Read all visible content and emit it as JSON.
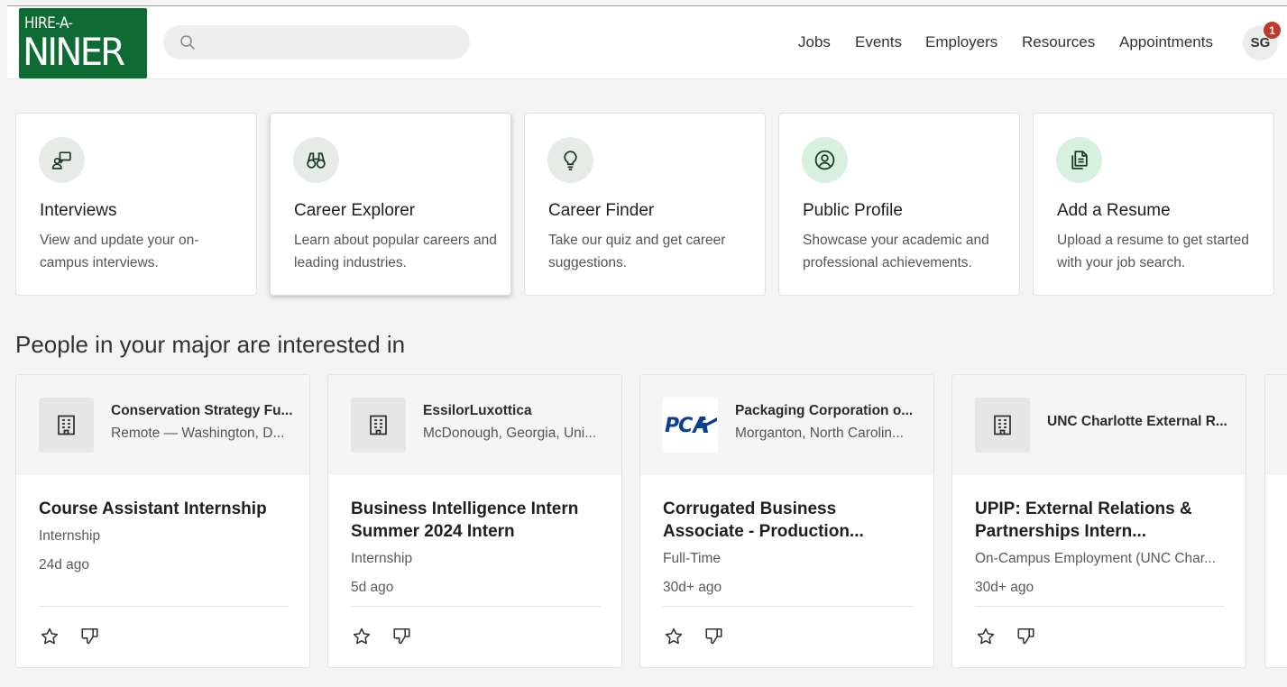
{
  "header": {
    "logo_line1": "HIRE-A-",
    "logo_line2": "NINER",
    "search_placeholder": "",
    "nav": [
      "Jobs",
      "Events",
      "Employers",
      "Resources",
      "Appointments"
    ],
    "avatar_initials": "SG",
    "notification_count": "1"
  },
  "tiles": [
    {
      "title": "Interviews",
      "desc": "View and update your on-campus interviews.",
      "icon": "interview-icon"
    },
    {
      "title": "Career Explorer",
      "desc": "Learn about popular careers and leading industries.",
      "icon": "binoculars-icon"
    },
    {
      "title": "Career Finder",
      "desc": "Take our quiz and get career suggestions.",
      "icon": "lightbulb-icon"
    },
    {
      "title": "Public Profile",
      "desc": "Showcase your academic and professional achievements.",
      "icon": "profile-icon"
    },
    {
      "title": "Add a Resume",
      "desc": "Upload a resume to get started with your job search.",
      "icon": "resume-icon"
    }
  ],
  "section_title": "People in your major are interested in",
  "jobs": [
    {
      "employer": "Conservation Strategy Fu...",
      "location": "Remote — Washington, D...",
      "title": "Course Assistant Internship",
      "type": "Internship",
      "age": "24d ago",
      "logo": "building-icon"
    },
    {
      "employer": "EssilorLuxottica",
      "location": "McDonough, Georgia, Uni...",
      "title": "Business Intelligence Intern Summer 2024 Intern",
      "type": "Internship",
      "age": "5d ago",
      "logo": "building-icon"
    },
    {
      "employer": "Packaging Corporation o...",
      "location": "Morganton, North Carolin...",
      "title": "Corrugated Business Associate - Production...",
      "type": "Full-Time",
      "age": "30d+ ago",
      "logo": "PCA"
    },
    {
      "employer": "UNC Charlotte External R...",
      "location": "",
      "title": "UPIP: External Relations & Partnerships Intern...",
      "type": "On-Campus Employment (UNC Char...",
      "age": "30d+ ago",
      "logo": "building-icon"
    }
  ],
  "colors": {
    "brand": "#0f6b34",
    "notification": "#c0392b",
    "pca_blue": "#0b3e91"
  }
}
